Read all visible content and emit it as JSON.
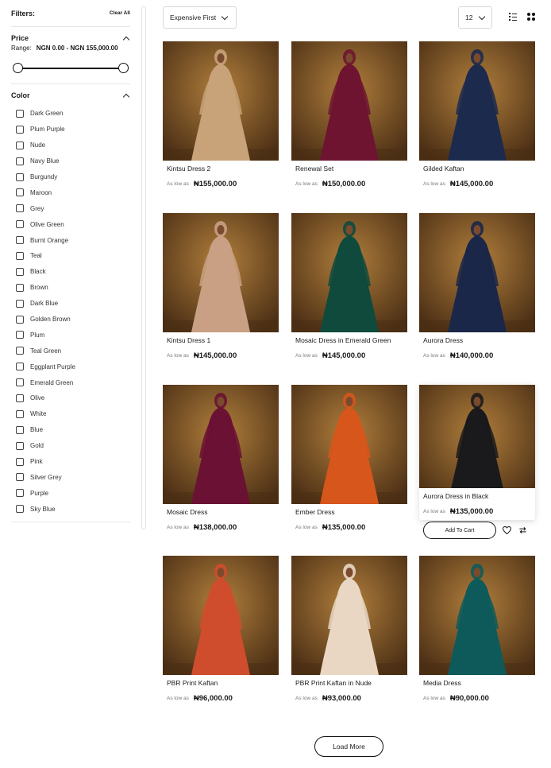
{
  "filters": {
    "title": "Filters:",
    "clear_all": "Clear All",
    "price": {
      "title": "Price",
      "range_label": "Range:",
      "range_value": "NGN 0.00 - NGN 155,000.00",
      "min": 0,
      "max": 155000
    },
    "color": {
      "title": "Color",
      "options": [
        "Dark Green",
        "Plum Purple",
        "Nude",
        "Navy Blue",
        "Burgundy",
        "Maroon",
        "Grey",
        "Olive Green",
        "Burnt Orange",
        "Teal",
        "Black",
        "Brown",
        "Dark Blue",
        "Golden Brown",
        "Plum",
        "Teal Green",
        "Eggplant Purple",
        "Emerald Green",
        "Olive",
        "White",
        "Blue",
        "Gold",
        "Pink",
        "Silver Grey",
        "Purple",
        "Sky Blue"
      ]
    }
  },
  "toolbar": {
    "sort_value": "Expensive First",
    "per_page_value": "12",
    "list_view_icon": "list-view-icon",
    "grid_view_icon": "grid-view-icon"
  },
  "price_prefix": "As low as",
  "products": [
    {
      "name": "Kintsu Dress 2",
      "price": "₦155,000.00",
      "dress": "#c8a37a"
    },
    {
      "name": "Renewal Set",
      "price": "₦150,000.00",
      "dress": "#6e1430"
    },
    {
      "name": "Gilded Kaftan",
      "price": "₦145,000.00",
      "dress": "#1c2a4e"
    },
    {
      "name": "Kintsu Dress 1",
      "price": "₦145,000.00",
      "dress": "#c9a083"
    },
    {
      "name": "Mosaic Dress in Emerald Green",
      "price": "₦145,000.00",
      "dress": "#0f4a3c"
    },
    {
      "name": "Aurora Dress",
      "price": "₦140,000.00",
      "dress": "#1b2748"
    },
    {
      "name": "Mosaic Dress",
      "price": "₦138,000.00",
      "dress": "#6a1134"
    },
    {
      "name": "Ember Dress",
      "price": "₦135,000.00",
      "dress": "#d6561b"
    },
    {
      "name": "Aurora Dress in Black",
      "price": "₦135,000.00",
      "dress": "#1a1a1c"
    },
    {
      "name": "PBR Print Kaftan",
      "price": "₦96,000.00",
      "dress": "#cf4d2c"
    },
    {
      "name": "PBR Print Kaftan in Nude",
      "price": "₦93,000.00",
      "dress": "#e9d7c4"
    },
    {
      "name": "Media Dress",
      "price": "₦90,000.00",
      "dress": "#0e5a5a"
    }
  ],
  "hover_card": {
    "add_to_cart": "Add To Cart",
    "wishlist_icon": "heart-icon",
    "compare_icon": "compare-icon"
  },
  "load_more": "Load More",
  "colors": {
    "background_dark": "#4a2e14",
    "background_light": "#b07e3c",
    "skin": "#7a4a2e"
  }
}
